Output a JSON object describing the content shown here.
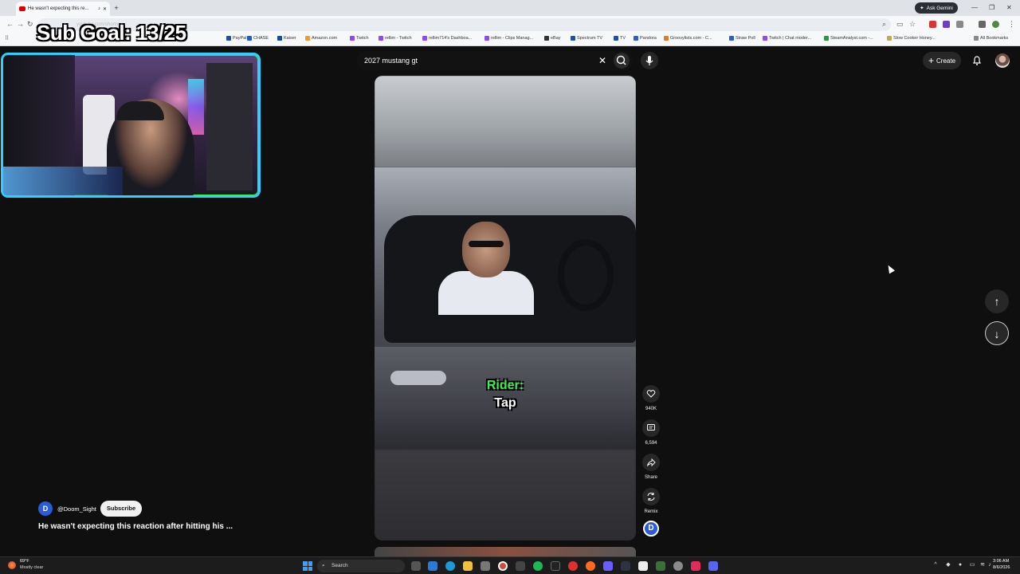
{
  "browser": {
    "tab_title": "He wasn't expecting this re...",
    "ask_gemini": "Ask Gemini",
    "url": "youtube.com/shorts/...",
    "bookmarks": [
      "PayPal",
      "CHASE",
      "Kaiser",
      "Amazon.com",
      "Twitch",
      "rellim - Twitch",
      "rellim714's Dashboa...",
      "rellim - Clips Manag...",
      "eBay",
      "Spectrum TV",
      "TV",
      "Pandora",
      "Groovylists.com - C...",
      "Straw Poll",
      "Twitch | Chat moder...",
      "SteamAnalyst.com -...",
      "Slow Cooker Honey..."
    ],
    "all_bookmarks": "All Bookmarks"
  },
  "overlay": {
    "sub_goal": "Sub Goal: 13/25"
  },
  "youtube": {
    "search_query": "2027 mustang gt",
    "create_label": "Create",
    "caption_speaker": "Rider:",
    "caption_text": "Tap",
    "actions": {
      "likes": "940K",
      "comments": "6,594",
      "share": "Share",
      "remix": "Remix"
    },
    "channel": {
      "avatar_letter": "D",
      "name": "@Doom_Sight",
      "subscribe": "Subscribe"
    },
    "video_title": "He wasn't expecting this reaction after hitting his ..."
  },
  "taskbar": {
    "weather_temp": "69°F",
    "weather_desc": "Mostly clear",
    "search_placeholder": "Search",
    "time": "3:06 AM",
    "date": "8/6/2026"
  },
  "colors": {
    "caption_speaker": "#3cf24a",
    "webcam_border": "#2fd0ff",
    "youtube_bg": "#0f0f0f"
  }
}
